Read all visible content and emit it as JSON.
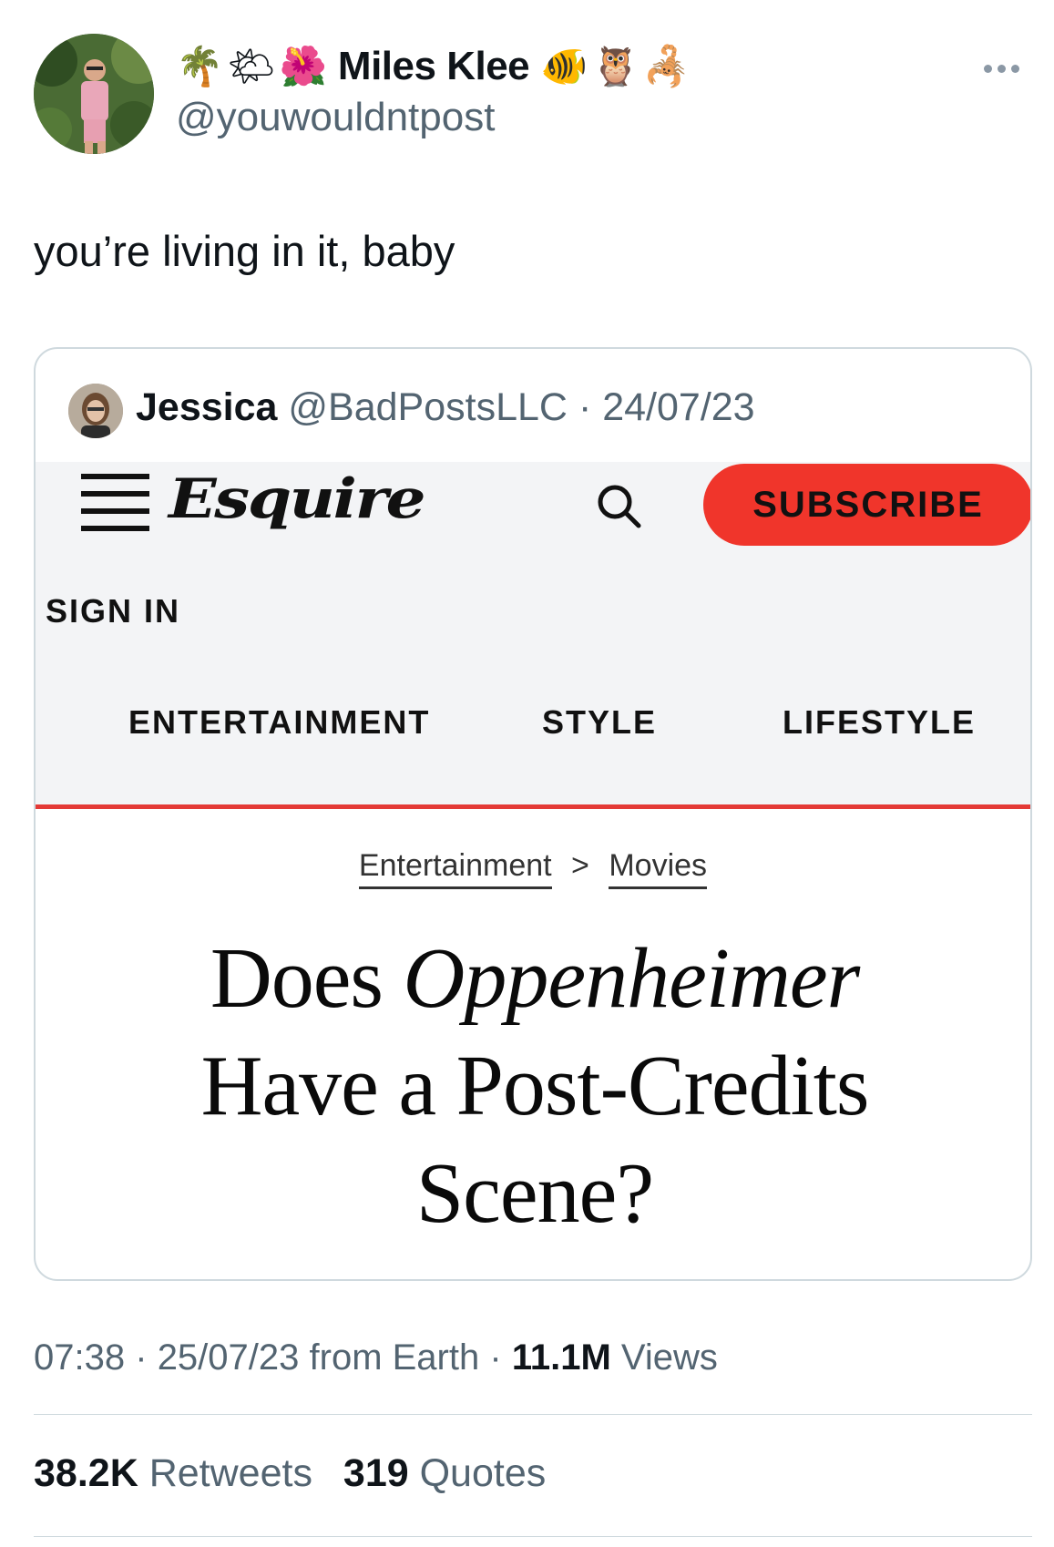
{
  "author": {
    "emoji_before": [
      "🌴",
      "🌤",
      "🌺"
    ],
    "display_name": "Miles Klee",
    "emoji_after": [
      "🐠",
      "🦉",
      "🦂"
    ],
    "handle": "@youwouldntpost"
  },
  "tweet": {
    "text": "you’re living in it, baby"
  },
  "quoted": {
    "name": "Jessica",
    "handle": "@BadPostsLLC",
    "separator": "·",
    "date": "24/07/23",
    "site": {
      "logo": "Esquire",
      "subscribe_label": "SUBSCRIBE",
      "signin_label": "SIGN IN",
      "nav": [
        "ENTERTAINMENT",
        "STYLE",
        "LIFESTYLE"
      ],
      "breadcrumb": [
        "Entertainment",
        "Movies"
      ],
      "breadcrumb_sep": ">",
      "headline": {
        "pre": "Does ",
        "italic": "Oppenheimer",
        "line2": "Have a Post-Credits",
        "line3": "Scene?"
      },
      "accent_color": "#f0352b",
      "rule_color": "#e43a36"
    }
  },
  "meta": {
    "time": "07:38",
    "sep": "·",
    "date": "25/07/23",
    "source": "from Earth",
    "views_count": "11.1M",
    "views_label": "Views"
  },
  "stats": {
    "retweets_count": "38.2K",
    "retweets_label": "Retweets",
    "quotes_count": "319",
    "quotes_label": "Quotes"
  }
}
